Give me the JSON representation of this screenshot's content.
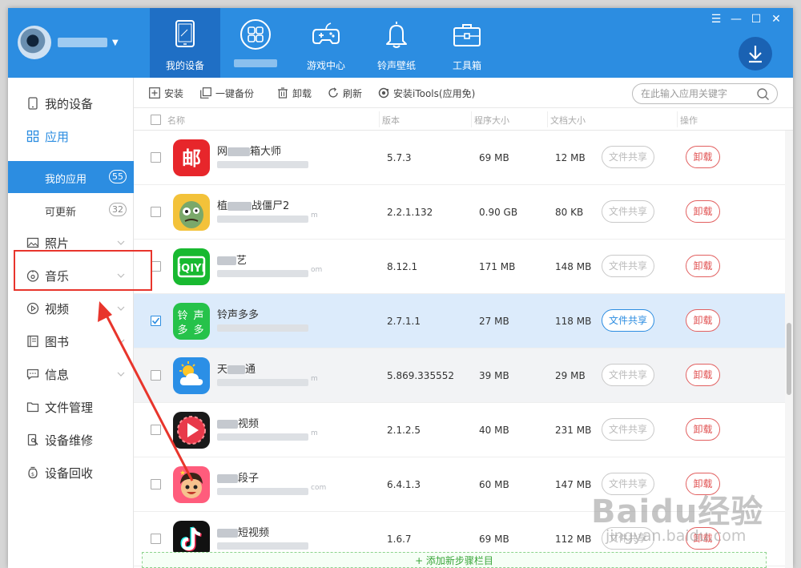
{
  "nav": {
    "tabs": [
      {
        "label": "我的设备",
        "icon": "tablet-icon"
      },
      {
        "label": "",
        "icon": "grid-apps-icon"
      },
      {
        "label": "游戏中心",
        "icon": "gamepad-icon"
      },
      {
        "label": "铃声壁纸",
        "icon": "bell-icon"
      },
      {
        "label": "工具箱",
        "icon": "toolbox-icon"
      }
    ]
  },
  "sidebar": {
    "items": [
      {
        "label": "我的设备",
        "icon": "phone-icon"
      },
      {
        "label": "应用",
        "icon": "apps-grid-icon"
      },
      {
        "label": "照片",
        "icon": "photo-icon"
      },
      {
        "label": "音乐",
        "icon": "music-icon"
      },
      {
        "label": "视频",
        "icon": "video-icon"
      },
      {
        "label": "图书",
        "icon": "book-icon"
      },
      {
        "label": "信息",
        "icon": "message-icon"
      },
      {
        "label": "文件管理",
        "icon": "folder-icon"
      },
      {
        "label": "设备维修",
        "icon": "repair-icon"
      },
      {
        "label": "设备回收",
        "icon": "recycle-icon"
      }
    ],
    "subitems": [
      {
        "label": "我的应用",
        "count": "55"
      },
      {
        "label": "可更新",
        "count": "32"
      }
    ]
  },
  "toolbar": {
    "install": "安装",
    "backup": "一键备份",
    "uninstall": "卸载",
    "refresh": "刷新",
    "install_itools": "安装iTools(应用免)",
    "search_placeholder": "在此输入应用关键字"
  },
  "table": {
    "headers": {
      "name": "名称",
      "version": "版本",
      "app_size": "程序大小",
      "doc_size": "文档大小",
      "action": "操作"
    },
    "share_label": "文件共享",
    "uninstall_label": "卸载",
    "rows": [
      {
        "name_pre": "网",
        "name_post": "箱大师",
        "version": "5.7.3",
        "app_size": "69 MB",
        "doc_size": "12 MB",
        "sub_tail": "",
        "checked": false
      },
      {
        "name_pre": "植",
        "name_post": "战僵尸2",
        "version": "2.2.1.132",
        "app_size": "0.90 GB",
        "doc_size": "80 KB",
        "sub_tail": "m",
        "checked": false
      },
      {
        "name_pre": "",
        "name_post": "艺",
        "version": "8.12.1",
        "app_size": "171 MB",
        "doc_size": "148 MB",
        "sub_tail": "om",
        "checked": false
      },
      {
        "name_pre": "铃声多多",
        "name_post": "",
        "version": "2.7.1.1",
        "app_size": "27 MB",
        "doc_size": "118 MB",
        "sub_tail": "",
        "checked": true
      },
      {
        "name_pre": "天",
        "name_post": "通",
        "version": "5.869.335552",
        "app_size": "39 MB",
        "doc_size": "29 MB",
        "sub_tail": "m",
        "checked": false
      },
      {
        "name_pre": "",
        "name_post": "视频",
        "version": "2.1.2.5",
        "app_size": "40 MB",
        "doc_size": "231 MB",
        "sub_tail": "m",
        "checked": false
      },
      {
        "name_pre": "",
        "name_post": "段子",
        "version": "6.4.1.3",
        "app_size": "60 MB",
        "doc_size": "147 MB",
        "sub_tail": "com",
        "checked": false
      },
      {
        "name_pre": "",
        "name_post": "短视频",
        "version": "1.6.7",
        "app_size": "69 MB",
        "doc_size": "112 MB",
        "sub_tail": "",
        "checked": false
      }
    ],
    "add_bar": "+ 添加新步骤栏目"
  },
  "watermark": {
    "main": "Baidu经验",
    "sub": "jingyan.baidu.com"
  },
  "colors": {
    "brand_blue": "#2c8de1",
    "dark_blue": "#1f6fc5",
    "danger_red": "#e05050",
    "annotation_red": "#e8352c"
  }
}
